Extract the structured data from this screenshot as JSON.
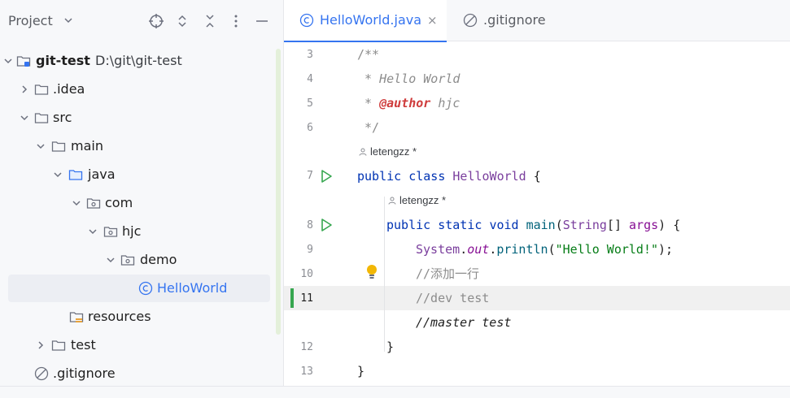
{
  "project_panel": {
    "title": "Project",
    "tree": [
      {
        "label": "git-test",
        "path": "D:\\git\\git-test",
        "icon": "module-folder-icon",
        "expanded": true
      },
      {
        "label": ".idea",
        "icon": "folder-icon",
        "expanded": false
      },
      {
        "label": "src",
        "icon": "folder-icon",
        "expanded": true
      },
      {
        "label": "main",
        "icon": "folder-icon",
        "expanded": true
      },
      {
        "label": "java",
        "icon": "source-folder-icon",
        "expanded": true
      },
      {
        "label": "com",
        "icon": "package-icon",
        "expanded": true
      },
      {
        "label": "hjc",
        "icon": "package-icon",
        "expanded": true
      },
      {
        "label": "demo",
        "icon": "package-icon",
        "expanded": true
      },
      {
        "label": "HelloWorld",
        "icon": "java-class-icon",
        "selected": true
      },
      {
        "label": "resources",
        "icon": "resources-folder-icon"
      },
      {
        "label": "test",
        "icon": "folder-icon",
        "expanded": false
      },
      {
        "label": ".gitignore",
        "icon": "ignored-file-icon"
      }
    ]
  },
  "tabs": [
    {
      "label": "HelloWorld.java",
      "active": true,
      "icon": "java-class-icon",
      "close": "×"
    },
    {
      "label": ".gitignore",
      "active": false,
      "icon": "ignored-file-icon"
    }
  ],
  "editor": {
    "author_hint": "letengzz *",
    "line_numbers": [
      "3",
      "4",
      "5",
      "6",
      "7",
      "8",
      "9",
      "10",
      "11",
      "12",
      "13"
    ],
    "lines": {
      "l3": "/**",
      "l4": " * Hello World",
      "l5_prefix": " * ",
      "l5_tag": "@author",
      "l5_suffix": " hjc",
      "l6": " */",
      "l7_kw1": "public",
      "l7_kw2": "class",
      "l7_name": "HelloWorld",
      "l7_brace": " {",
      "l8_kw1": "public",
      "l8_kw2": "static",
      "l8_kw3": "void",
      "l8_name": "main",
      "l8_params_open": "(",
      "l8_type": "String",
      "l8_params_rest": "[] ",
      "l8_arg": "args",
      "l8_close": ") {",
      "l9_obj": "System",
      "l9_dot1": ".",
      "l9_field": "out",
      "l9_dot2": ".",
      "l9_method": "println",
      "l9_open": "(",
      "l9_str": "\"Hello World!\"",
      "l9_close": ");",
      "l10": "//添加一行",
      "l11": "//dev test",
      "l11b": "//master test",
      "l12": "}",
      "l13": "}"
    }
  },
  "colors": {
    "accent": "#3574f0",
    "keyword": "#0033b3",
    "comment": "#8c8c8c",
    "modified": "#36a64f"
  }
}
